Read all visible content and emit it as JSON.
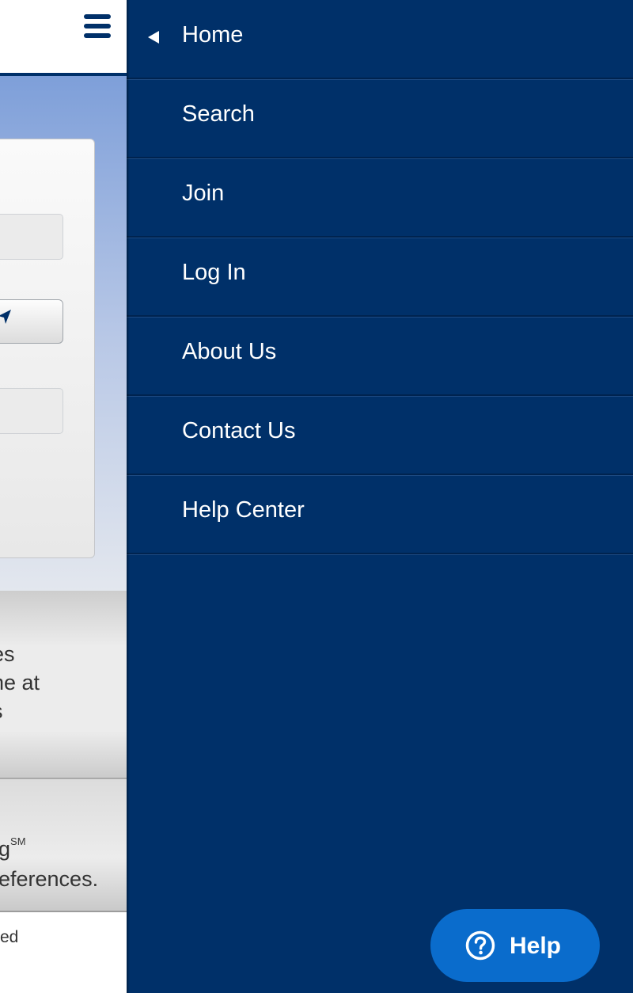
{
  "background_page": {
    "band_1_text": "es\nne at\ns",
    "band_2_text": "g",
    "band_2_superscript": "SM",
    "band_2_text_line2": "eferences.",
    "footer_text": "ed"
  },
  "menu": {
    "items": [
      {
        "label": "Home"
      },
      {
        "label": "Search"
      },
      {
        "label": "Join"
      },
      {
        "label": "Log In"
      },
      {
        "label": "About Us"
      },
      {
        "label": "Contact Us"
      },
      {
        "label": "Help Center"
      }
    ]
  },
  "help_button": {
    "label": "Help",
    "icon": "question-circle-icon"
  },
  "colors": {
    "drawer_bg": "#003069",
    "help_button_bg": "#0a6ccc",
    "brand_navy": "#003069"
  }
}
